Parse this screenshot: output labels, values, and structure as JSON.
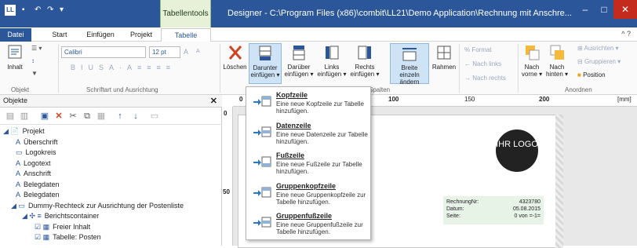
{
  "titlebar": {
    "app_icon_text": "LL",
    "context_tab_group": "Tabellentools",
    "window_title": "Designer - C:\\Program Files (x86)\\combit\\LL21\\Demo Application\\Rechnung mit Anschre...",
    "minimize": "–",
    "restore": "□",
    "close": "✕"
  },
  "tabs": [
    "Datei",
    "Start",
    "Einfügen",
    "Projekt",
    "Tabelle"
  ],
  "tabbar_right": "^  ?",
  "ribbon": {
    "objekt": {
      "inhalt_label": "Inhalt",
      "group_title": "Objekt"
    },
    "font": {
      "font_name": "Calibri",
      "font_size": "12 pt",
      "grow": "A",
      "shrink": "A",
      "group_title": "Schriftart und Ausrichtung"
    },
    "table": {
      "loeschen": "Löschen",
      "darunter": "Darunter einfügen ▾",
      "darueber": "Darüber einfügen ▾",
      "links": "Links einfügen ▾",
      "rechts": "Rechts einfügen ▾",
      "breite": "Breite einzeln ändern",
      "rahmen": "Rahmen",
      "group_title": "Spalten"
    },
    "format": {
      "format": "Format",
      "nach_links": "Nach links",
      "nach_rechts": "Nach rechts"
    },
    "anordnen": {
      "nach_vorne": "Nach vorne ▾",
      "nach_hinten": "Nach hinten ▾",
      "ausrichten": "Ausrichten ▾",
      "gruppieren": "Gruppieren ▾",
      "position": "Position",
      "group_title": "Anordnen"
    }
  },
  "objects_panel": {
    "title": "Objekte",
    "close": "✕",
    "tree": [
      {
        "label": "Projekt",
        "prefix": "◢ 📄",
        "indent": 4
      },
      {
        "label": "Überschrift",
        "prefix": "A",
        "indent": 20
      },
      {
        "label": "Logokreis",
        "prefix": "▭",
        "indent": 20
      },
      {
        "label": "Logotext",
        "prefix": "A",
        "indent": 20
      },
      {
        "label": "Anschrift",
        "prefix": "A",
        "indent": 20
      },
      {
        "label": "Belegdaten",
        "prefix": "A",
        "indent": 20
      },
      {
        "label": "Belegdaten",
        "prefix": "A",
        "indent": 20
      },
      {
        "label": "Dummy-Rechteck zur Ausrichtung der Postenliste",
        "prefix": "◢ ▭",
        "indent": 14
      },
      {
        "label": "Berichtscontainer",
        "prefix": "◢ ✣ ≡",
        "indent": 28
      },
      {
        "label": "Freier Inhalt",
        "prefix": "☑ ▦",
        "indent": 44
      },
      {
        "label": "Tabelle: Posten",
        "prefix": "☑ ▦",
        "indent": 44
      }
    ]
  },
  "dropdown": [
    {
      "title": "Kopfzeile",
      "desc": "Eine neue Kopfzeile zur Tabelle hinzufügen."
    },
    {
      "title": "Datenzeile",
      "desc": "Eine neue Datenzeile zur Tabelle hinzufügen."
    },
    {
      "title": "Fußzeile",
      "desc": "Eine neue Fußzeile zur Tabelle hinzufügen."
    },
    {
      "title": "Gruppenkopfzeile",
      "desc": "Eine neue Gruppenkopfzeile zur Tabelle hinzufügen."
    },
    {
      "title": "Gruppenfußzeile",
      "desc": "Eine neue Gruppenfußzeile zur Tabelle hinzufügen."
    }
  ],
  "ruler": {
    "top": [
      "0",
      "100",
      "150",
      "200",
      "[mm]"
    ],
    "left": [
      "0",
      "50"
    ]
  },
  "page": {
    "logo": "IHR LOGO",
    "meta": [
      {
        "label": "RechnungNr:",
        "value": "4323780"
      },
      {
        "label": "Datum:",
        "value": "05.08.2015"
      },
      {
        "label": "Seite:",
        "value": "0 von =-1="
      }
    ]
  }
}
